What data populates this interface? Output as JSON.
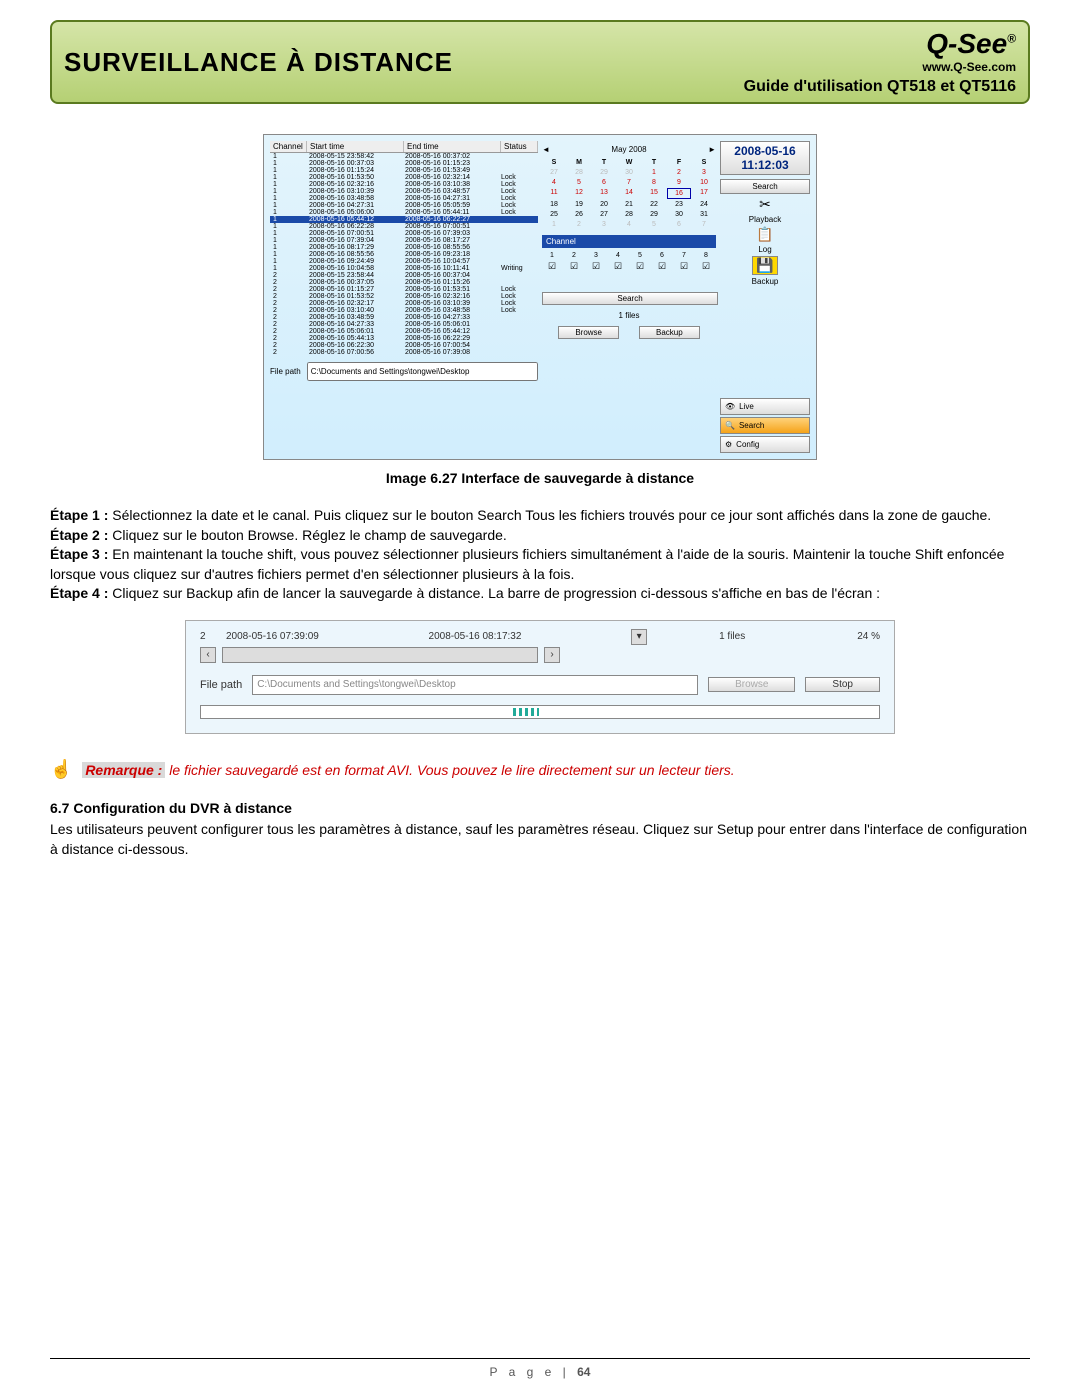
{
  "header": {
    "title": "SURVEILLANCE À DISTANCE",
    "guide": "Guide d'utilisation QT518 et QT5116",
    "logo_text": "Q-See",
    "logo_url": "www.Q-See.com"
  },
  "screenshot1": {
    "cols": {
      "ch": "Channel",
      "start": "Start time",
      "end": "End time",
      "status": "Status"
    },
    "rows": [
      {
        "c": "1",
        "s": "2008-05-15 23:58:42",
        "e": "2008-05-16 00:37:02",
        "st": ""
      },
      {
        "c": "1",
        "s": "2008-05-16 00:37:03",
        "e": "2008-05-16 01:15:23",
        "st": ""
      },
      {
        "c": "1",
        "s": "2008-05-16 01:15:24",
        "e": "2008-05-16 01:53:49",
        "st": ""
      },
      {
        "c": "1",
        "s": "2008-05-16 01:53:50",
        "e": "2008-05-16 02:32:14",
        "st": "Lock"
      },
      {
        "c": "1",
        "s": "2008-05-16 02:32:16",
        "e": "2008-05-16 03:10:38",
        "st": "Lock"
      },
      {
        "c": "1",
        "s": "2008-05-16 03:10:39",
        "e": "2008-05-16 03:48:57",
        "st": "Lock"
      },
      {
        "c": "1",
        "s": "2008-05-16 03:48:58",
        "e": "2008-05-16 04:27:31",
        "st": "Lock"
      },
      {
        "c": "1",
        "s": "2008-05-16 04:27:31",
        "e": "2008-05-16 05:05:59",
        "st": "Lock"
      },
      {
        "c": "1",
        "s": "2008-05-16 05:06:00",
        "e": "2008-05-16 05:44:11",
        "st": "Lock"
      },
      {
        "c": "1",
        "s": "2008-05-16 05:44:12",
        "e": "2008-05-16 06:22:27",
        "st": "",
        "sel": true
      },
      {
        "c": "1",
        "s": "2008-05-16 06:22:28",
        "e": "2008-05-16 07:00:51",
        "st": ""
      },
      {
        "c": "1",
        "s": "2008-05-16 07:00:51",
        "e": "2008-05-16 07:39:03",
        "st": ""
      },
      {
        "c": "1",
        "s": "2008-05-16 07:39:04",
        "e": "2008-05-16 08:17:27",
        "st": ""
      },
      {
        "c": "1",
        "s": "2008-05-16 08:17:29",
        "e": "2008-05-16 08:55:56",
        "st": ""
      },
      {
        "c": "1",
        "s": "2008-05-16 08:55:56",
        "e": "2008-05-16 09:23:18",
        "st": ""
      },
      {
        "c": "1",
        "s": "2008-05-16 09:24:49",
        "e": "2008-05-16 10:04:57",
        "st": ""
      },
      {
        "c": "1",
        "s": "2008-05-16 10:04:58",
        "e": "2008-05-16 10:11:41",
        "st": "Writing"
      },
      {
        "c": "2",
        "s": "2008-05-15 23:58:44",
        "e": "2008-05-16 00:37:04",
        "st": ""
      },
      {
        "c": "2",
        "s": "2008-05-16 00:37:05",
        "e": "2008-05-16 01:15:26",
        "st": ""
      },
      {
        "c": "2",
        "s": "2008-05-16 01:15:27",
        "e": "2008-05-16 01:53:51",
        "st": "Lock"
      },
      {
        "c": "2",
        "s": "2008-05-16 01:53:52",
        "e": "2008-05-16 02:32:16",
        "st": "Lock"
      },
      {
        "c": "2",
        "s": "2008-05-16 02:32:17",
        "e": "2008-05-16 03:10:39",
        "st": "Lock"
      },
      {
        "c": "2",
        "s": "2008-05-16 03:10:40",
        "e": "2008-05-16 03:48:58",
        "st": "Lock"
      },
      {
        "c": "2",
        "s": "2008-05-16 03:48:59",
        "e": "2008-05-16 04:27:33",
        "st": ""
      },
      {
        "c": "2",
        "s": "2008-05-16 04:27:33",
        "e": "2008-05-16 05:06:01",
        "st": ""
      },
      {
        "c": "2",
        "s": "2008-05-16 05:06:01",
        "e": "2008-05-16 05:44:12",
        "st": ""
      },
      {
        "c": "2",
        "s": "2008-05-16 05:44:13",
        "e": "2008-05-16 06:22:29",
        "st": ""
      },
      {
        "c": "2",
        "s": "2008-05-16 06:22:30",
        "e": "2008-05-16 07:00:54",
        "st": ""
      },
      {
        "c": "2",
        "s": "2008-05-16 07:00:56",
        "e": "2008-05-16 07:39:08",
        "st": ""
      }
    ],
    "filepath_label": "File path",
    "filepath_value": "C:\\Documents and Settings\\tongwei\\Desktop",
    "cal": {
      "month": "May 2008",
      "days": [
        "S",
        "M",
        "T",
        "W",
        "T",
        "F",
        "S"
      ],
      "prev_tail": [
        "27",
        "28",
        "29",
        "30"
      ],
      "grid": [
        [
          "",
          "",
          "",
          "",
          "1",
          "2",
          "3"
        ],
        [
          "4",
          "5",
          "6",
          "7",
          "8",
          "9",
          "10"
        ],
        [
          "11",
          "12",
          "13",
          "14",
          "15",
          "16",
          "17"
        ],
        [
          "18",
          "19",
          "20",
          "21",
          "22",
          "23",
          "24"
        ],
        [
          "25",
          "26",
          "27",
          "28",
          "29",
          "30",
          "31"
        ]
      ],
      "next_head": [
        "1",
        "2",
        "3",
        "4",
        "5",
        "6",
        "7"
      ],
      "selected": "16"
    },
    "channel_label": "Channel",
    "channels": [
      "1",
      "2",
      "3",
      "4",
      "5",
      "6",
      "7",
      "8"
    ],
    "search_btn": "Search",
    "files_txt": "1 files",
    "browse_btn": "Browse",
    "backup_btn": "Backup",
    "dt_date": "2008-05-16",
    "dt_time": "11:12:03",
    "side_search": "Search",
    "side_playback": "Playback",
    "side_log": "Log",
    "side_backup": "Backup",
    "mode_live": "Live",
    "mode_search": "Search",
    "mode_config": "Config"
  },
  "caption1": "Image 6.27 Interface de sauvegarde à distance",
  "steps": {
    "s1b": "Étape 1 :",
    "s1": " Sélectionnez la date et le canal. Puis cliquez sur le bouton Search Tous les fichiers trouvés pour ce jour sont affichés dans la zone de gauche.",
    "s2b": "Étape 2 :",
    "s2": " Cliquez sur le bouton Browse. Réglez le champ de sauvegarde.",
    "s3b": "Étape 3 :",
    "s3": " En maintenant la touche shift, vous pouvez sélectionner plusieurs fichiers simultanément à l'aide de la souris. Maintenir la touche Shift enfoncée lorsque vous cliquez sur d'autres fichiers permet d'en sélectionner plusieurs à la fois.",
    "s4b": "Étape 4 :",
    "s4": " Cliquez sur Backup afin de lancer la sauvegarde à distance. La barre de progression ci-dessous s'affiche en bas de l'écran :"
  },
  "screenshot2": {
    "ch": "2",
    "start": "2008-05-16 07:39:09",
    "end": "2008-05-16 08:17:32",
    "files": "1 files",
    "pct": "24 %",
    "filepath_label": "File path",
    "filepath_value": "C:\\Documents and Settings\\tongwei\\Desktop",
    "browse": "Browse",
    "stop": "Stop"
  },
  "note": {
    "label": "Remarque :",
    "text": " le fichier sauvegardé est en format AVI. Vous pouvez le lire directement sur un lecteur tiers."
  },
  "sec67_h": "6.7 Configuration du DVR à distance",
  "sec67_p": "Les utilisateurs peuvent configurer tous les paramètres à distance, sauf les paramètres réseau. Cliquez sur Setup pour entrer dans l'interface de configuration à distance ci-dessous.",
  "footer": {
    "p": "P a g e  | ",
    "n": "64"
  }
}
